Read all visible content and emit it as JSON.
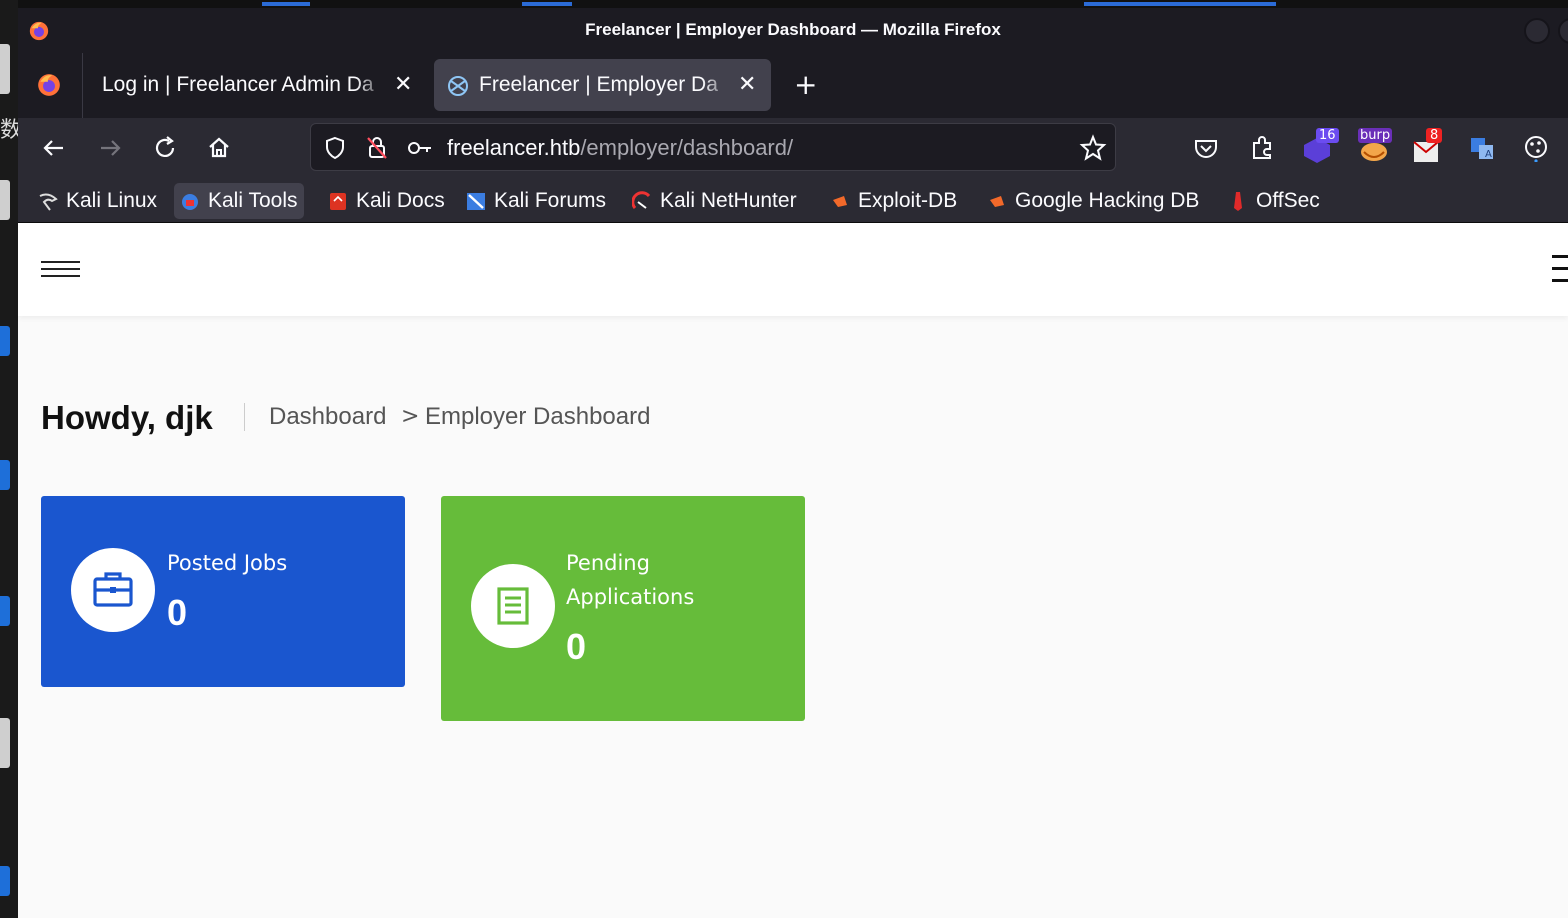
{
  "window": {
    "title": "Freelancer | Employer Dashboard — Mozilla Firefox"
  },
  "tabs": [
    {
      "label": "Log in | Freelancer Admin Da",
      "active": false
    },
    {
      "label": "Freelancer | Employer Da",
      "active": true
    }
  ],
  "newtab_label": "+",
  "urlbar": {
    "host": "freelancer.htb",
    "path": "/employer/dashboard/"
  },
  "toolbar_badges": {
    "extension_count": "16",
    "burp": "burp",
    "mail_count": "8"
  },
  "bookmarks": [
    {
      "label": "Kali Linux",
      "icon": "kali-dragon-icon"
    },
    {
      "label": "Kali Tools",
      "icon": "kali-tools-icon",
      "highlighted": true
    },
    {
      "label": "Kali Docs",
      "icon": "kali-docs-icon"
    },
    {
      "label": "Kali Forums",
      "icon": "kali-forums-icon"
    },
    {
      "label": "Kali NetHunter",
      "icon": "nethunter-icon"
    },
    {
      "label": "Exploit-DB",
      "icon": "exploit-db-icon"
    },
    {
      "label": "Google Hacking DB",
      "icon": "ghdb-icon"
    },
    {
      "label": "OffSec",
      "icon": "offsec-icon"
    }
  ],
  "page": {
    "greeting": "Howdy, djk",
    "breadcrumb": {
      "item1": "Dashboard",
      "separator": ">",
      "item2": "Employer Dashboard"
    },
    "cards": [
      {
        "label": "Posted Jobs",
        "value": "0",
        "color": "#1a56cf",
        "icon": "briefcase-icon"
      },
      {
        "label_line1": "Pending",
        "label_line2": "Applications",
        "value": "0",
        "color": "#66bc3a",
        "icon": "document-icon"
      }
    ]
  },
  "colors": {
    "firefox_dark": "#1c1b22",
    "toolbar": "#2b2a33",
    "active_tab": "#42414d"
  }
}
